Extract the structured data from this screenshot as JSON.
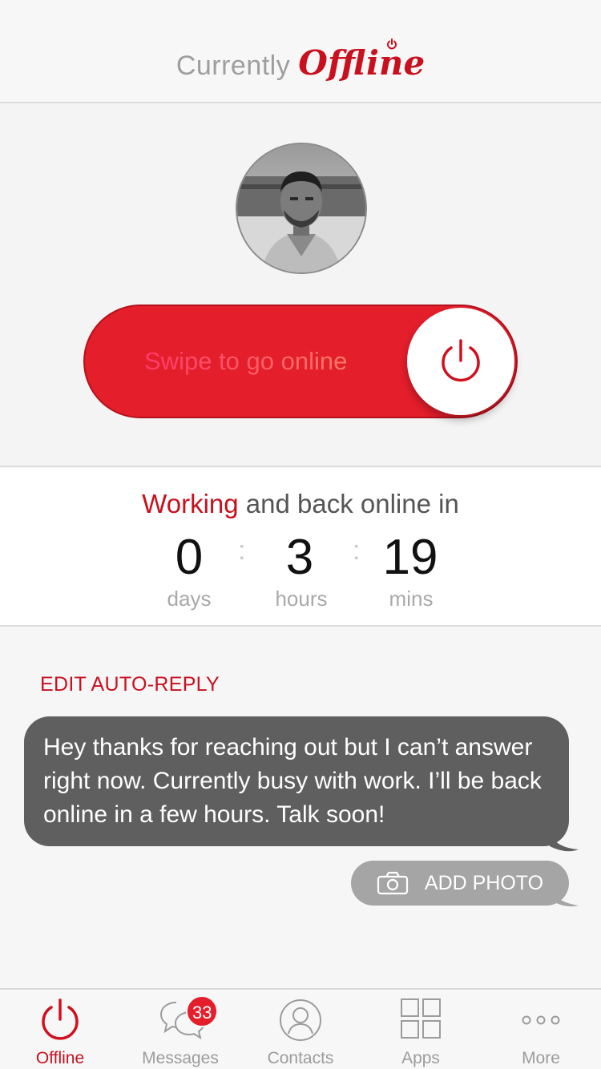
{
  "header": {
    "prefix": "Currently",
    "status": "Offline"
  },
  "swipe": {
    "label": "Swipe to go online",
    "knob_icon": "power-icon"
  },
  "timer": {
    "status_word": "Working",
    "status_rest": "and back online in",
    "units": [
      {
        "value": "0",
        "label": "days"
      },
      {
        "value": "3",
        "label": "hours"
      },
      {
        "value": "19",
        "label": "mins"
      }
    ],
    "separator": ":"
  },
  "auto_reply": {
    "edit_label": "EDIT AUTO-REPLY",
    "message": "Hey thanks for reaching out but I can’t answer right now. Currently busy with work. I’ll be back online in a few hours. Talk soon!",
    "add_photo_label": "ADD PHOTO"
  },
  "tabs": [
    {
      "label": "Offline",
      "icon": "power-icon",
      "active": true
    },
    {
      "label": "Messages",
      "icon": "chat-bubbles-icon",
      "badge": "33"
    },
    {
      "label": "Contacts",
      "icon": "person-icon"
    },
    {
      "label": "Apps",
      "icon": "grid-icon"
    },
    {
      "label": "More",
      "icon": "more-dots-icon"
    }
  ],
  "colors": {
    "accent": "#c8101e",
    "swipe_bg": "#e41e2b",
    "bubble_bg": "#5f5f5f",
    "photo_button_bg": "#a5a5a5"
  }
}
